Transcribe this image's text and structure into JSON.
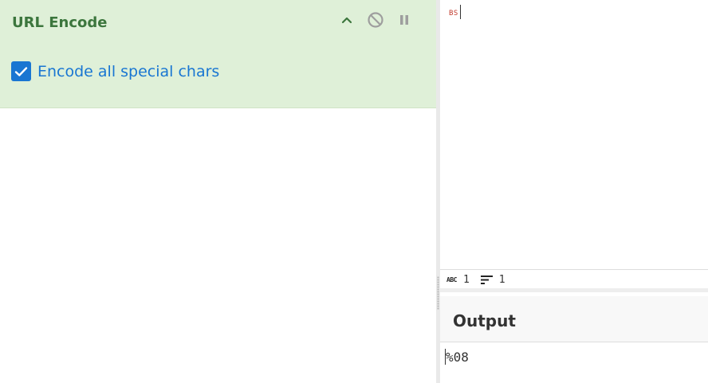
{
  "recipe": {
    "operation": {
      "title": "URL Encode",
      "controls": {
        "collapse_icon": "chevron-up-icon",
        "disable_icon": "disable-icon",
        "breakpoint_icon": "pause-icon"
      },
      "option": {
        "label": "Encode all special chars",
        "checked": true
      },
      "colors": {
        "card_bg": "#dff0d8",
        "title": "#3c763d",
        "accent": "#1976d2"
      }
    }
  },
  "io": {
    "input": {
      "content_glyph": "BS"
    },
    "stats": {
      "length_icon": "abc-icon",
      "length": "1",
      "lines_icon": "lines-icon",
      "lines": "1"
    },
    "output": {
      "title": "Output",
      "value": "%08"
    }
  }
}
